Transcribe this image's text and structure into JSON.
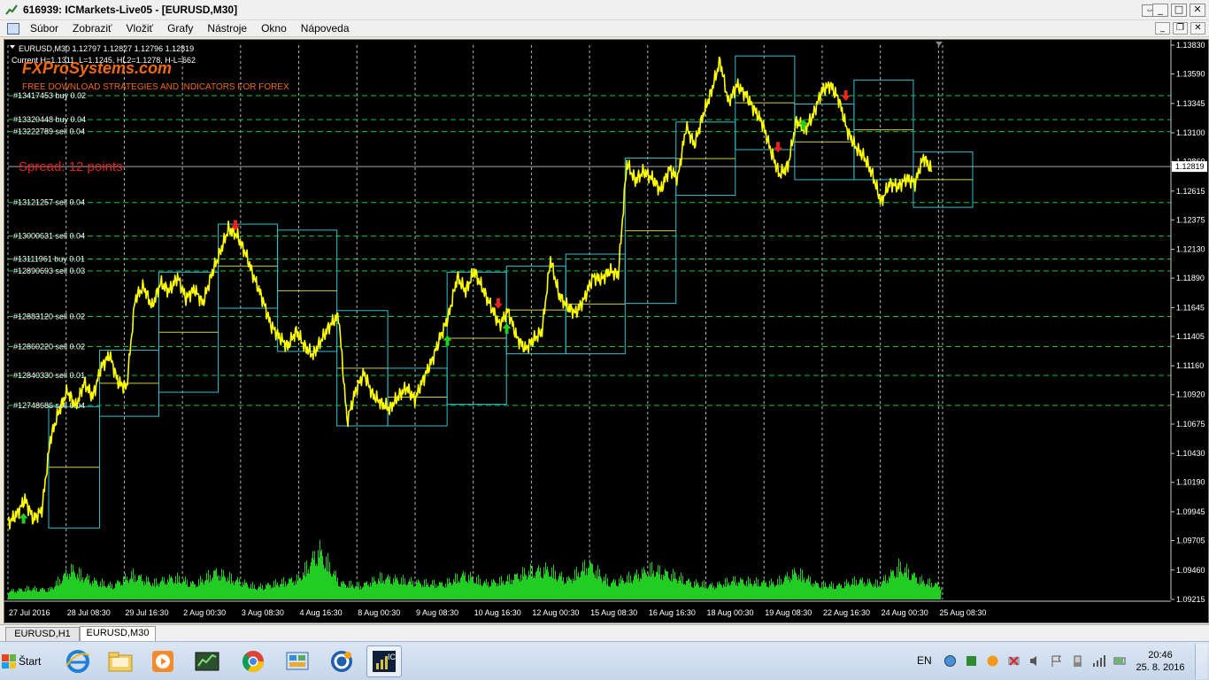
{
  "window": {
    "title": "616939: ICMarkets-Live05 - [EURUSD,M30]",
    "restore_glyph": "⇔",
    "controls": {
      "minimize": "_",
      "maximize": "□",
      "close": "✕"
    }
  },
  "menubar": {
    "items": [
      "Súbor",
      "Zobraziť",
      "Vložiť",
      "Grafy",
      "Nástroje",
      "Okno",
      "Nápoveda"
    ],
    "mdi_controls": {
      "minimize": "_",
      "restore": "❐",
      "close": "✕"
    }
  },
  "chart": {
    "symbol_line": "EURUSD,M30  1.12797 1.12827 1.12796 1.12819",
    "info_line": "Current H=1.1311, L=1.1245, HL2=1.1278, H-L=662",
    "watermark_title": "FXProSystems.com",
    "watermark_sub": "FREE DOWNLOAD STRATEGIES AND INDICATORS FOR FOREX",
    "spread_text": "Spread: 12 points",
    "current_price": "1.12819",
    "colors": {
      "background": "#000000",
      "price": "#ffff00",
      "volume": "#22cc22",
      "level": "#00cc44",
      "box_cyan": "#30c0d0",
      "box_yellow": "#d0d040",
      "grid": "#d8d8d8",
      "arrow_up": "#22cc22",
      "arrow_down": "#ee2222",
      "spread_text": "#dd2222"
    }
  },
  "orders": [
    {
      "label": "#13417453 buy 0.02",
      "price": 1.1341
    },
    {
      "label": "#13320448 buy 0.04",
      "price": 1.1321
    },
    {
      "label": "#13222789 sell 0.04",
      "price": 1.1311
    },
    {
      "label": "#13121257 sell 0.04",
      "price": 1.1252
    },
    {
      "label": "#13000631 sell 0.04",
      "price": 1.1224
    },
    {
      "label": "#13111961 buy 0.01",
      "price": 1.1205
    },
    {
      "label": "#12890693 sell 0.03",
      "price": 1.1195
    },
    {
      "label": "#12883120 sell 0.02",
      "price": 1.1157
    },
    {
      "label": "#12860220 sell 0.02",
      "price": 1.1132
    },
    {
      "label": "#12840330 sell 0.01",
      "price": 1.1108
    },
    {
      "label": "#12748686 sell 0.04",
      "price": 1.1083
    }
  ],
  "chart_data": {
    "type": "line",
    "title": "EURUSD,M30",
    "ylim": [
      1.09215,
      1.1383
    ],
    "y_ticks": [
      "1.13830",
      "1.13590",
      "1.13345",
      "1.13100",
      "1.12860",
      "1.12615",
      "1.12375",
      "1.12130",
      "1.11890",
      "1.11645",
      "1.11405",
      "1.11160",
      "1.10920",
      "1.10675",
      "1.10430",
      "1.10190",
      "1.09945",
      "1.09705",
      "1.09460",
      "1.09215"
    ],
    "x_ticks": [
      "27 Jul 2016",
      "28 Jul 08:30",
      "29 Jul 16:30",
      "2 Aug 00:30",
      "3 Aug 08:30",
      "4 Aug 16:30",
      "8 Aug 00:30",
      "9 Aug 08:30",
      "10 Aug 16:30",
      "12 Aug 00:30",
      "15 Aug 08:30",
      "16 Aug 16:30",
      "18 Aug 00:30",
      "19 Aug 08:30",
      "22 Aug 16:30",
      "24 Aug 00:30",
      "25 Aug 08:30"
    ],
    "series": [
      {
        "values": [
          1.0985,
          1.0992,
          1.1005,
          1.0988,
          1.0996,
          1.1055,
          1.1078,
          1.1095,
          1.1082,
          1.1102,
          1.109,
          1.1115,
          1.1125,
          1.1102,
          1.1098,
          1.1172,
          1.1182,
          1.1165,
          1.1185,
          1.1178,
          1.119,
          1.1172,
          1.118,
          1.1168,
          1.1192,
          1.121,
          1.123,
          1.1225,
          1.121,
          1.119,
          1.1172,
          1.115,
          1.114,
          1.1132,
          1.1145,
          1.1132,
          1.1125,
          1.1138,
          1.115,
          1.1158,
          1.107,
          1.1095,
          1.111,
          1.1092,
          1.1085,
          1.108,
          1.109,
          1.1098,
          1.1088,
          1.1105,
          1.112,
          1.114,
          1.1158,
          1.119,
          1.1178,
          1.1195,
          1.118,
          1.1165,
          1.115,
          1.1162,
          1.114,
          1.113,
          1.1138,
          1.1145,
          1.1205,
          1.1175,
          1.1165,
          1.116,
          1.1172,
          1.119,
          1.1188,
          1.1195,
          1.1192,
          1.1285,
          1.127,
          1.1278,
          1.1272,
          1.1262,
          1.128,
          1.1272,
          1.1315,
          1.13,
          1.1325,
          1.1345,
          1.137,
          1.1335,
          1.135,
          1.1342,
          1.133,
          1.1318,
          1.1295,
          1.1275,
          1.1282,
          1.132,
          1.1312,
          1.1325,
          1.1345,
          1.135,
          1.1338,
          1.1312,
          1.1298,
          1.129,
          1.1275,
          1.1252,
          1.1268,
          1.1265,
          1.1272,
          1.1268,
          1.129,
          1.1278
        ]
      }
    ],
    "volume_peaks": [
      0.15,
      0.2,
      0.18,
      0.55,
      0.35,
      0.25,
      0.45,
      0.3,
      0.4,
      0.28,
      0.5,
      0.35,
      0.22,
      0.3,
      0.38,
      0.9,
      0.3,
      0.25,
      0.4,
      0.35,
      0.3,
      0.28,
      0.45,
      0.3,
      0.35,
      0.5,
      0.55,
      0.35,
      0.65,
      0.3,
      0.4,
      0.55,
      0.45,
      0.3,
      0.25,
      0.35,
      0.32,
      0.3,
      0.5,
      0.28,
      0.25,
      0.35,
      0.28,
      0.6,
      0.35,
      0.25
    ]
  },
  "tabs": [
    "EURUSD,H1",
    "EURUSD,M30"
  ],
  "taskbar": {
    "start_label": "Štart",
    "apps": [
      "internet-explorer-icon",
      "explorer-folder-icon",
      "media-player-icon",
      "terminal-icon",
      "chrome-icon",
      "control-panel-icon",
      "ccleaner-icon",
      "metatrader-icon"
    ],
    "language": "EN",
    "clock_time": "20:46",
    "clock_date": "25. 8. 2016"
  }
}
